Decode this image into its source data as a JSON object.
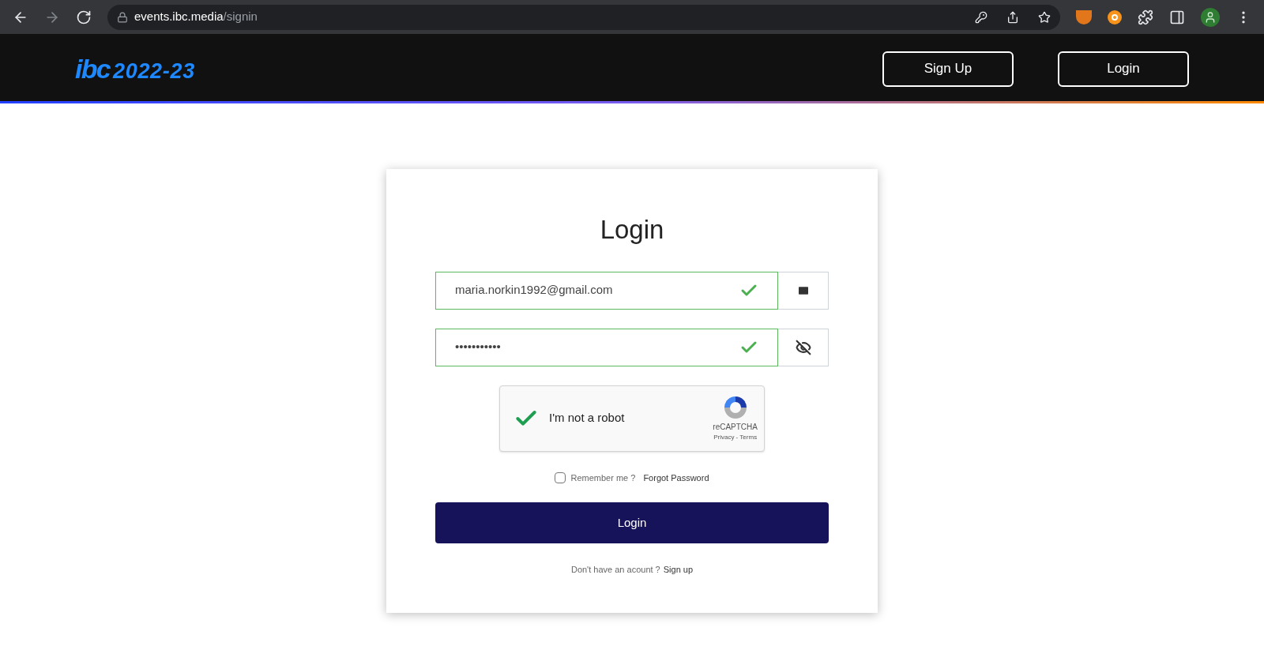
{
  "browser": {
    "url_host": "events.ibc.media",
    "url_path": "/signin"
  },
  "header": {
    "logo": {
      "brand": "ibc",
      "years": "2022-23"
    },
    "buttons": [
      "Sign Up",
      "Login"
    ]
  },
  "form": {
    "title": "Login",
    "email": {
      "value": "maria.norkin1992@gmail.com",
      "valid": true
    },
    "password": {
      "value": "•••••••••••",
      "valid": true
    },
    "captcha": {
      "label": "I'm not a robot",
      "checked": true,
      "brand": "reCAPTCHA",
      "links": "Privacy - Terms"
    },
    "remember": {
      "label": "Remember me ?",
      "checked": false
    },
    "forgot": "Forgot Password",
    "submit": "Login",
    "signup_prompt": "Don't have an acount ?",
    "signup_link": "Sign up"
  }
}
